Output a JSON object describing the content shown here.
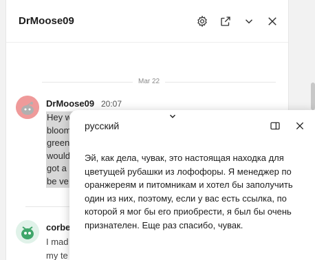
{
  "chat": {
    "title": "DrMoose09",
    "date_separator": "Mar 22",
    "messages": [
      {
        "author": "DrMoose09",
        "time": "20:07",
        "lines": [
          "Hey w",
          "bloom",
          "green",
          "would",
          "got a",
          "be ve"
        ]
      },
      {
        "author": "corbe",
        "lines": [
          "I mad",
          "my te"
        ]
      }
    ]
  },
  "translation": {
    "language": "русский",
    "text": "Эй, как дела, чувак, это настоящая находка для цветущей рубашки из лофофоры. Я менеджер по оранжереям и питомникам и хотел бы заполучить один из них, поэтому, если у вас есть ссылка, по которой я мог бы его приобрести, я был бы очень признателен. Еще раз спасибо, чувак."
  },
  "icons": {
    "header": [
      "gear-icon",
      "external-link-icon",
      "chevron-down-icon",
      "close-icon"
    ],
    "popup": [
      "sidebar-panel-icon",
      "close-icon"
    ]
  },
  "colors": {
    "selection_highlight": "#d7d7d7",
    "avatar1": "#ef9a9a",
    "avatar2": "#e0f2e9"
  }
}
